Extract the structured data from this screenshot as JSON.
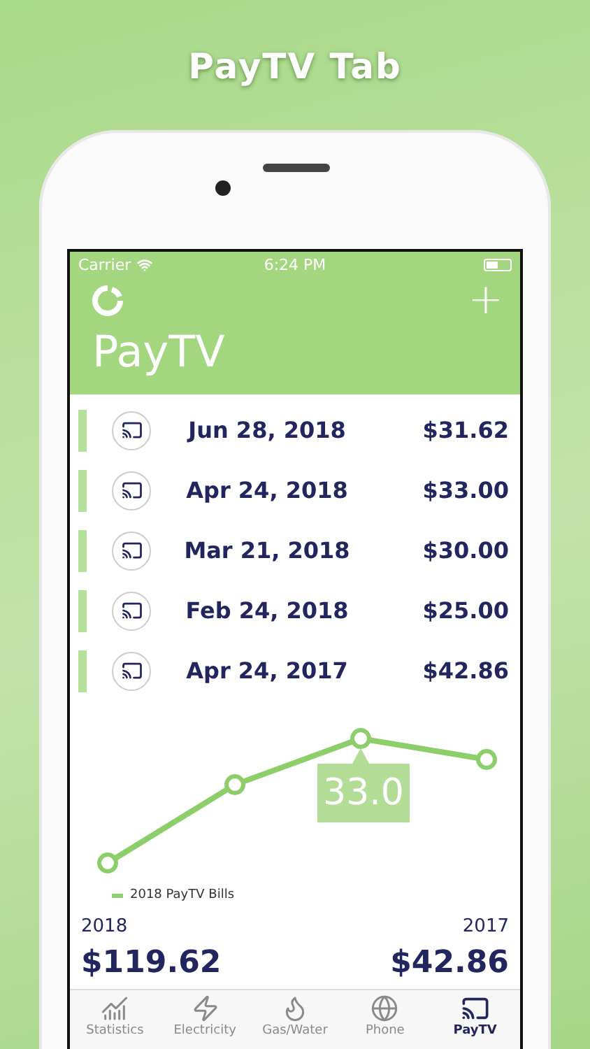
{
  "caption": "PayTV Tab",
  "status_bar": {
    "carrier": "Carrier",
    "time": "6:24 PM"
  },
  "header": {
    "title": "PayTV",
    "add_button": "+"
  },
  "bills": [
    {
      "date": "Jun 28, 2018",
      "amount": "$31.62"
    },
    {
      "date": "Apr 24, 2018",
      "amount": "$33.00"
    },
    {
      "date": "Mar 21, 2018",
      "amount": "$30.00"
    },
    {
      "date": "Feb 24, 2018",
      "amount": "$25.00"
    },
    {
      "date": "Apr 24, 2017",
      "amount": "$42.86"
    }
  ],
  "chart": {
    "tooltip": "33.0",
    "legend": "2018 PayTV Bills"
  },
  "totals": [
    {
      "year": "2018",
      "amount": "$119.62"
    },
    {
      "year": "2017",
      "amount": "$42.86"
    }
  ],
  "tab_bar": [
    {
      "label": "Statistics",
      "selected": false
    },
    {
      "label": "Electricity",
      "selected": false
    },
    {
      "label": "Gas/Water",
      "selected": false
    },
    {
      "label": "Phone",
      "selected": false
    },
    {
      "label": "PayTV",
      "selected": true
    }
  ]
}
